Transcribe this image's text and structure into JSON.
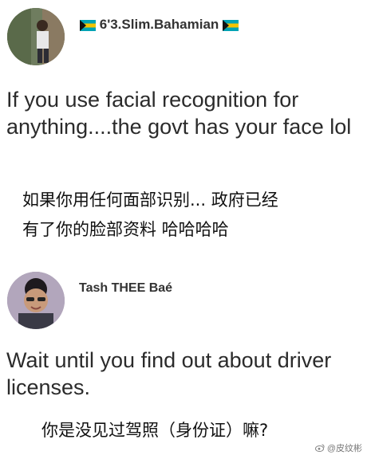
{
  "post1": {
    "username": "6'3.Slim.Bahamian",
    "text": "If you use facial recognition for anything....the govt has your face lol",
    "translation_line1": "如果你用任何面部识别... 政府已经",
    "translation_line2": "有了你的脸部资料  哈哈哈哈"
  },
  "post2": {
    "username": "Tash THEE Baé",
    "text": "Wait until you find out about driver licenses.",
    "translation": "你是没见过驾照（身份证）嘛?"
  },
  "watermark": {
    "text": "@皮纹彬"
  },
  "colors": {
    "flag_aqua": "#00a3b4",
    "flag_yellow": "#f5c400",
    "flag_black": "#111111"
  }
}
